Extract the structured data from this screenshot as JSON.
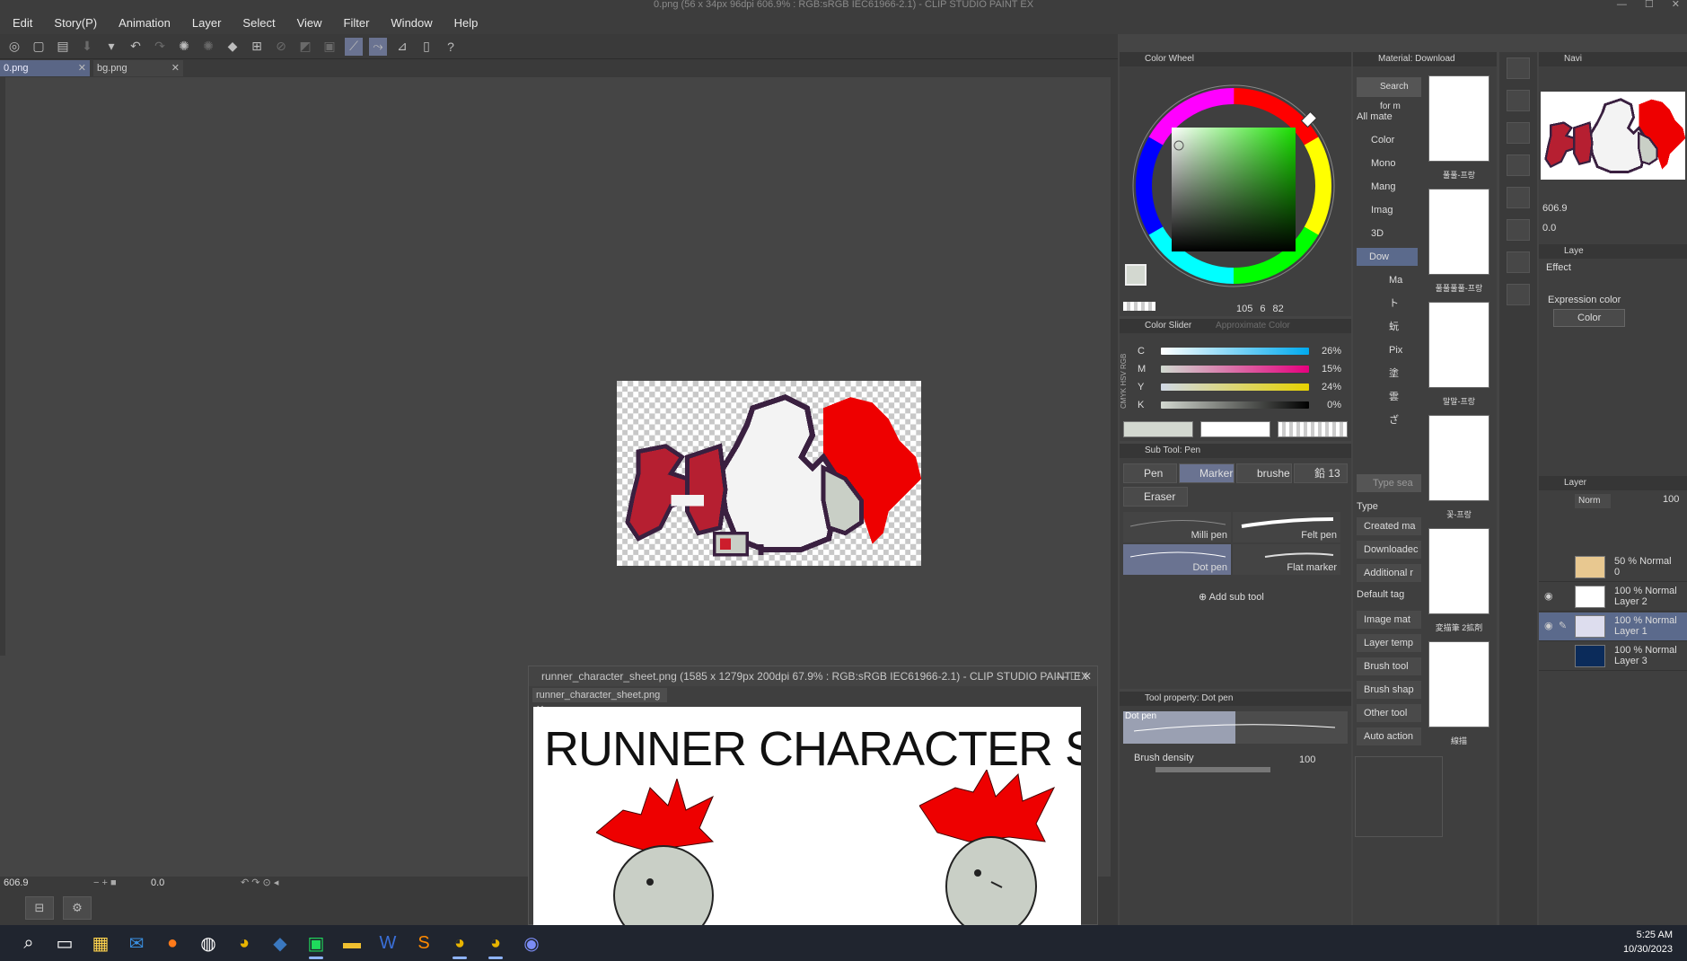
{
  "window": {
    "title": "0.png (56 x 34px 96dpi 606.9% : RGB:sRGB IEC61966-2.1) - CLIP STUDIO PAINT EX"
  },
  "menu": [
    "Edit",
    "Story(P)",
    "Animation",
    "Layer",
    "Select",
    "View",
    "Filter",
    "Window",
    "Help"
  ],
  "tabs": [
    {
      "label": "0.png"
    },
    {
      "label": "bg.png"
    }
  ],
  "status": {
    "zoom": "606.9",
    "angle": "0.0"
  },
  "subwindow": {
    "title": "runner_character_sheet.png (1585 x 1279px 200dpi 67.9% : RGB:sRGB IEC61966-2.1) - CLIP STUDIO PAINT EX",
    "tab": "runner_character_sheet.png",
    "heading": "RUNNER CHARACTER SH"
  },
  "color_wheel": {
    "title": "Color Wheel",
    "h": "105",
    "s": "6",
    "v": "82",
    "fg": "#d3d8d0",
    "bg": "#ffffff"
  },
  "color_slider": {
    "title": "Color Slider",
    "tab2": "Approximate Color",
    "modes": "CMYK HSV RGB",
    "rows": [
      {
        "label": "C",
        "value": "26%"
      },
      {
        "label": "M",
        "value": "15%"
      },
      {
        "label": "Y",
        "value": "24%"
      },
      {
        "label": "K",
        "value": "0%"
      }
    ]
  },
  "sub_tool": {
    "title": "Sub Tool: Pen",
    "groups": [
      {
        "label": "Pen"
      },
      {
        "label": "Marker"
      },
      {
        "label": "brushe"
      },
      {
        "label": "鉛 13"
      },
      {
        "label": "Eraser"
      }
    ],
    "brushes": [
      {
        "label": "Milli pen"
      },
      {
        "label": "Felt pen"
      },
      {
        "label": "Dot pen"
      },
      {
        "label": "Flat marker"
      }
    ],
    "add": "Add sub tool"
  },
  "tool_property": {
    "title": "Tool property: Dot pen",
    "preview_label": "Dot pen",
    "density_label": "Brush density",
    "density_value": "100"
  },
  "material": {
    "title": "Material: Download",
    "search": "Search for m",
    "tree": [
      "All mate",
      "Color",
      "Mono",
      "Mang",
      "Imag",
      "3D",
      "Dow",
      "Ma",
      "ト",
      "蚖",
      "Pix",
      "塗",
      "雲",
      "ざ"
    ],
    "thumbs": [
      "풀풀-프랑",
      "풀풀풀풀-프랑",
      "말말-프랑",
      "꽃-프랑",
      "変描筆 2拡剤",
      "線描"
    ],
    "search2": "Type sea",
    "type_label": "Type",
    "types": [
      "Created ma",
      "Downloadec",
      "Additional r"
    ],
    "default_tag": "Default tag",
    "tags": [
      "Image mat",
      "Layer temp",
      "Brush tool",
      "Brush shap",
      "Other tool",
      "Auto action"
    ]
  },
  "navigator": {
    "title": "Navi",
    "zoom": "606.9",
    "angle": "0.0"
  },
  "layer_property": {
    "title": "Laye",
    "effect": "Effect",
    "expr_label": "Expression color",
    "expr_value": "Color"
  },
  "layers": {
    "title": "Layer",
    "blend": "Norm",
    "opacity": "100",
    "items": [
      {
        "l1": "50 % Normal",
        "l2": "0"
      },
      {
        "l1": "100 % Normal",
        "l2": "Layer 2"
      },
      {
        "l1": "100 % Normal",
        "l2": "Layer 1"
      },
      {
        "l1": "100 % Normal",
        "l2": "Layer 3"
      }
    ]
  },
  "taskbar": {
    "time": "5:25 AM",
    "date": "10/30/2023"
  }
}
